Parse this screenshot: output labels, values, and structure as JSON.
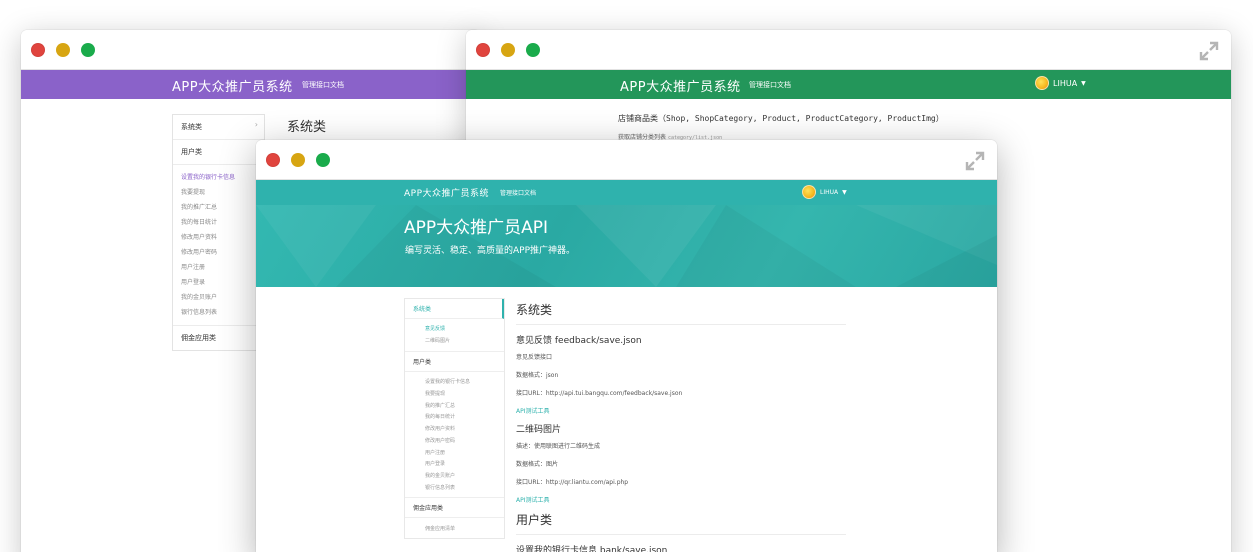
{
  "window1": {
    "brand": "APP大众推广员系统",
    "nav_link": "管理接口文档",
    "section_title": "系统类",
    "sidebar": {
      "categories": [
        "系统类",
        "用户类",
        "佣金应用类"
      ],
      "items": [
        "设置我的银行卡信息",
        "我要提现",
        "我的推广汇总",
        "我的每日统计",
        "修改用户资料",
        "修改用户密码",
        "用户注册",
        "用户登录",
        "我的金贝账户",
        "银行信息列表"
      ]
    }
  },
  "window2": {
    "brand": "APP大众推广员系统",
    "nav_link": "管理接口文档",
    "user": "LIHUA",
    "shop_title": "店铺商品类（Shop, ShopCategory, Product, ProductCategory, ProductImg）",
    "shop_sub": "获取店铺分类列表",
    "shop_sub_path": "category/list.json"
  },
  "window3": {
    "brand": "APP大众推广员系统",
    "nav_link": "管理接口文档",
    "user": "LIHUA",
    "hero_title": "APP大众推广员API",
    "hero_sub": "编写灵活、稳定、高质量的APP推广神器。",
    "sidebar": {
      "cat_system": "系统类",
      "system_items": [
        "意见反馈",
        "二维码图片"
      ],
      "cat_user": "用户类",
      "user_items": [
        "设置我的银行卡信息",
        "我要提现",
        "我的推广汇总",
        "我的每日统计",
        "修改用户资料",
        "修改用户密码",
        "用户注册",
        "用户登录",
        "我的金贝账户",
        "银行信息列表"
      ],
      "cat_commission": "佣金应用类",
      "commission_items": [
        "佣金应用清单"
      ]
    },
    "main": {
      "section_system": "系统类",
      "api1_title": "意见反馈 feedback/save.json",
      "api1_desc": "意见反馈接口",
      "api1_format": "数据格式：json",
      "api1_url": "接口URL：http://api.tui.bangqu.com/feedback/save.json",
      "api1_tool": "API测试工具",
      "api2_title": "二维码图片",
      "api2_desc": "描述：使用联图进行二维码生成",
      "api2_format": "数据格式：图片",
      "api2_url": "接口URL：http://qr.liantu.com/api.php",
      "api2_tool": "API测试工具",
      "section_user": "用户类",
      "api3_title": "设置我的银行卡信息 bank/save.json"
    }
  }
}
